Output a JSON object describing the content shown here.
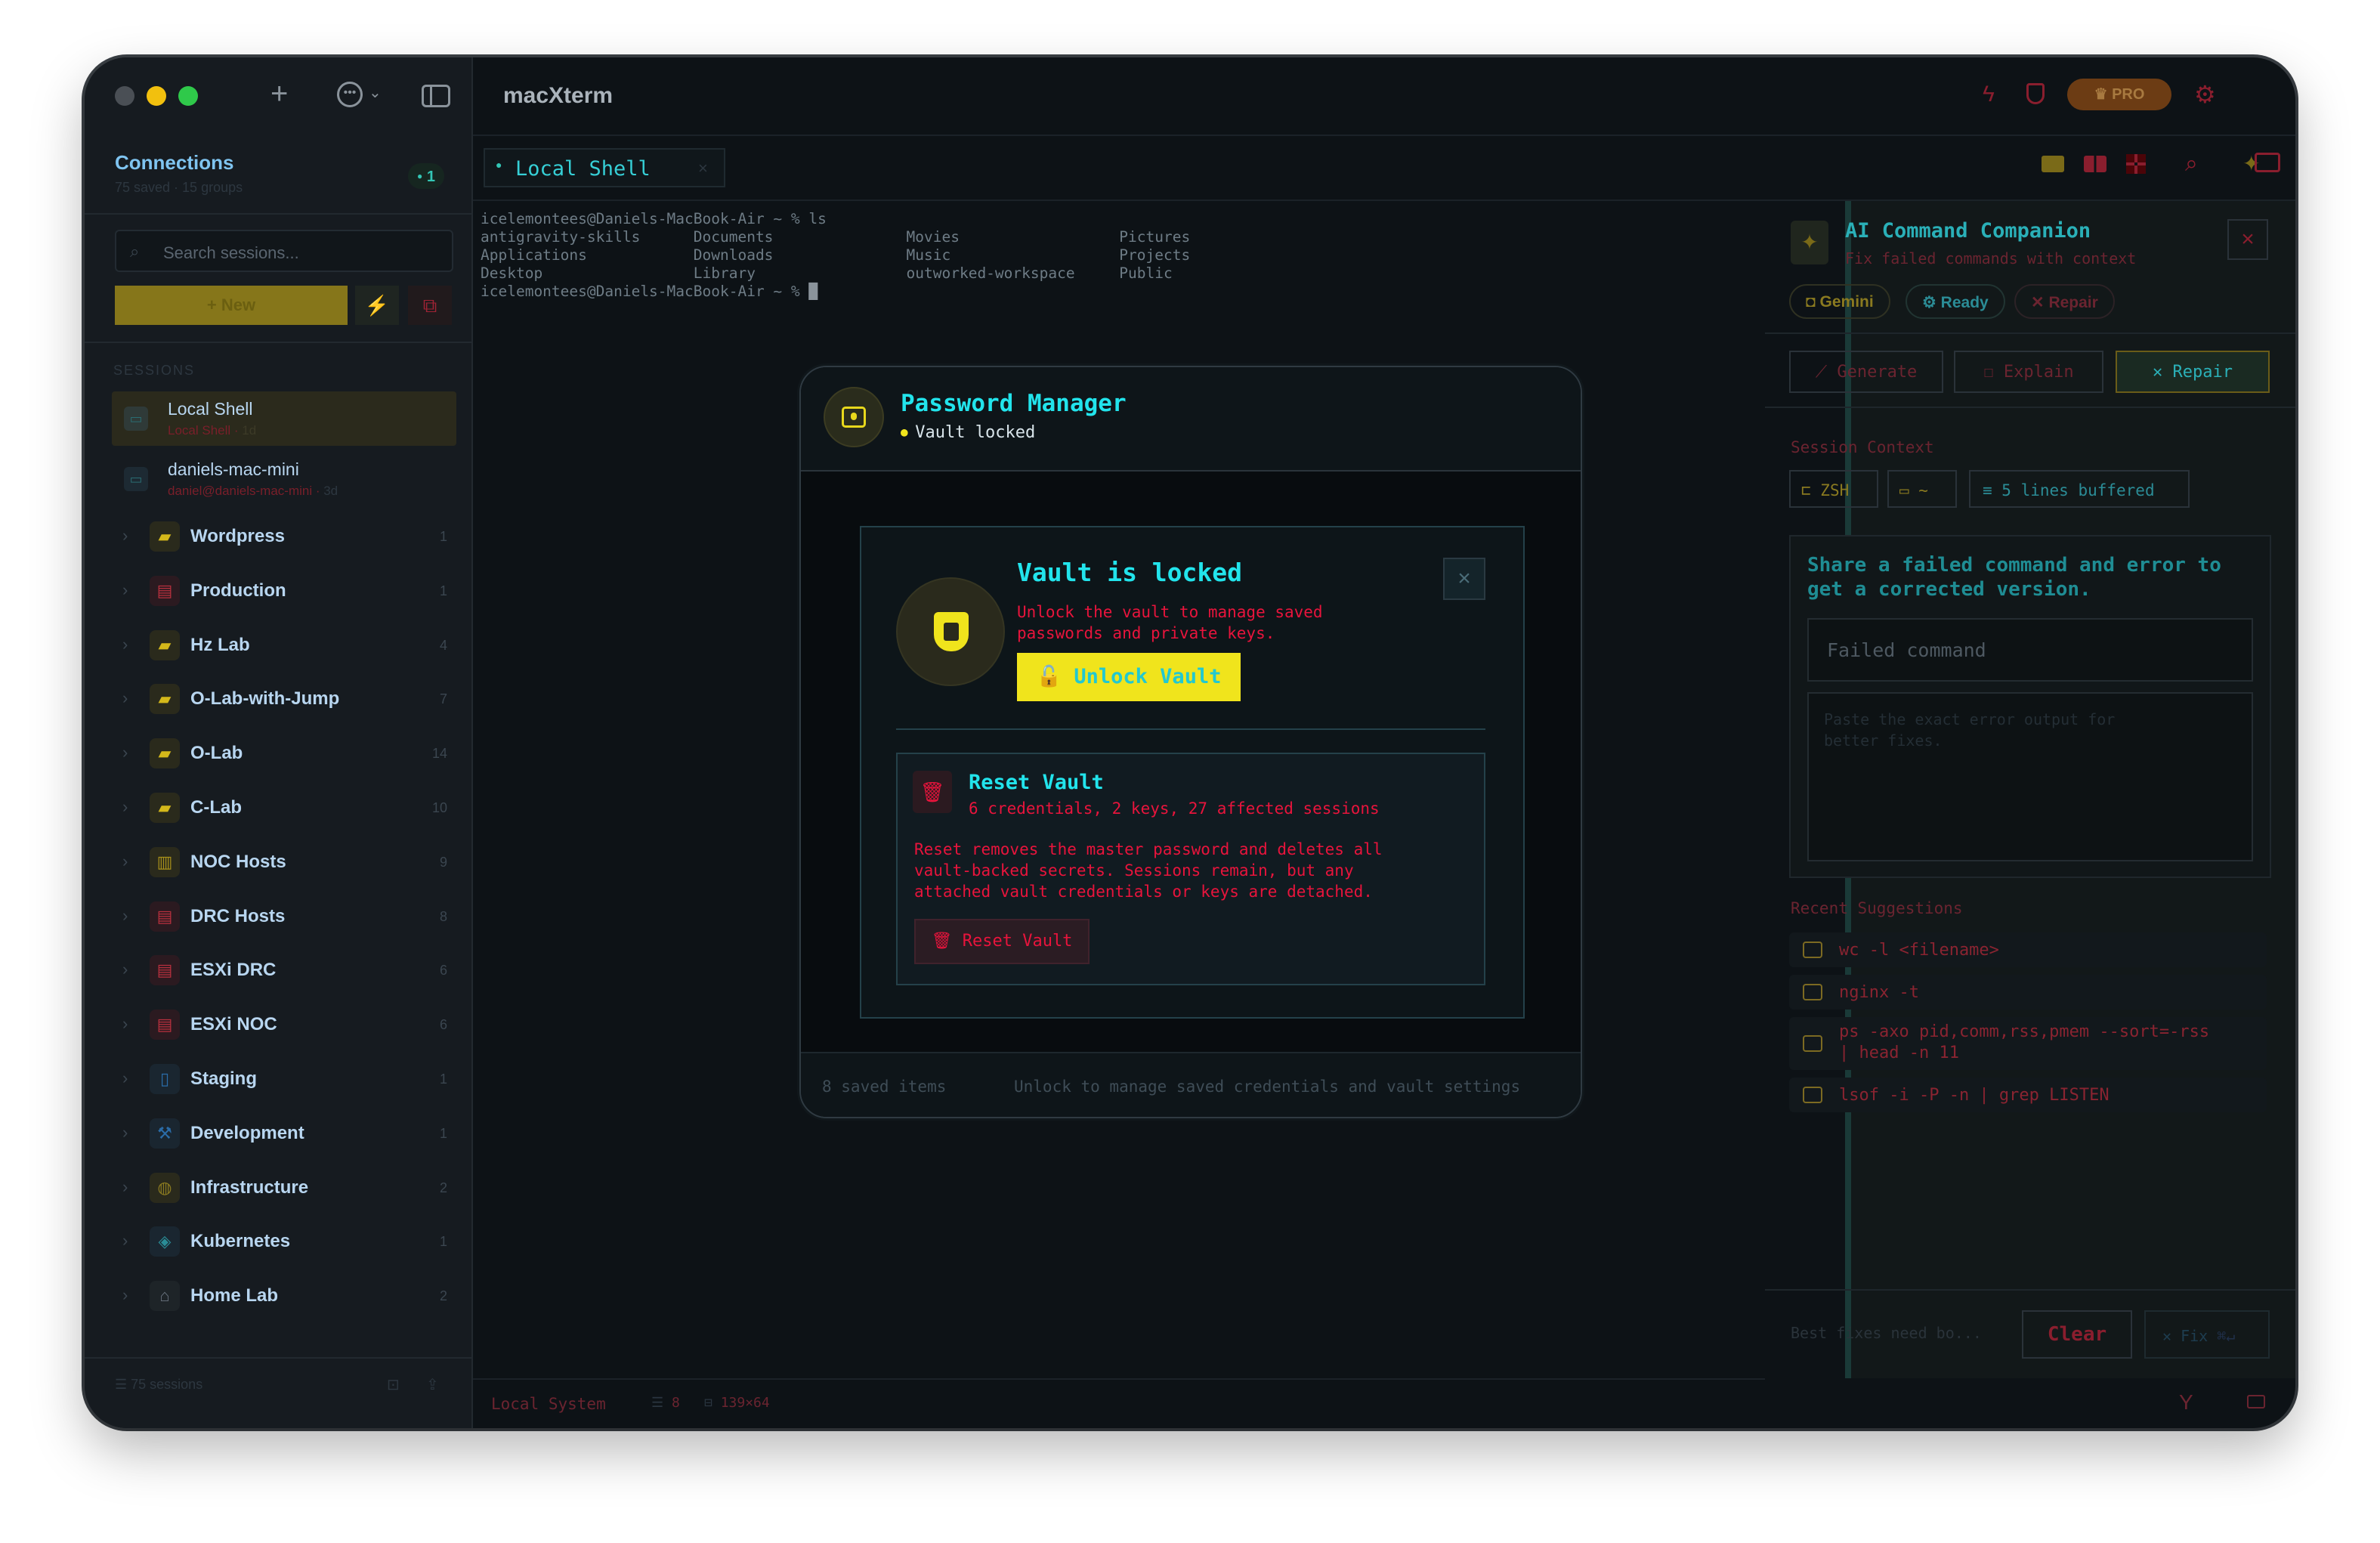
{
  "app": {
    "title": "macXterm"
  },
  "sidebar": {
    "title": "Connections",
    "subtitle": "75 saved · 15 groups",
    "badge": "1",
    "search_placeholder": "Search sessions...",
    "new_button": "+ New",
    "sessions_label": "SESSIONS",
    "sessions": [
      {
        "name": "Local Shell",
        "sub": "Local Shell",
        "meta": "1d"
      },
      {
        "name": "daniels-mac-mini",
        "sub": "daniel@daniels-mac-mini",
        "meta": "3d"
      }
    ],
    "groups": [
      {
        "label": "Wordpress",
        "count": "1",
        "icon": "folder-icon"
      },
      {
        "label": "Production",
        "count": "1",
        "icon": "server-icon"
      },
      {
        "label": "Hz Lab",
        "count": "4",
        "icon": "folder-icon"
      },
      {
        "label": "O-Lab-with-Jump",
        "count": "7",
        "icon": "folder-icon"
      },
      {
        "label": "O-Lab",
        "count": "14",
        "icon": "folder-icon"
      },
      {
        "label": "C-Lab",
        "count": "10",
        "icon": "folder-icon"
      },
      {
        "label": "NOC Hosts",
        "count": "9",
        "icon": "building-icon"
      },
      {
        "label": "DRC Hosts",
        "count": "8",
        "icon": "server-icon"
      },
      {
        "label": "ESXi DRC",
        "count": "6",
        "icon": "server-icon"
      },
      {
        "label": "ESXi NOC",
        "count": "6",
        "icon": "server-icon"
      },
      {
        "label": "Staging",
        "count": "1",
        "icon": "columns-icon"
      },
      {
        "label": "Development",
        "count": "1",
        "icon": "hammer-icon"
      },
      {
        "label": "Infrastructure",
        "count": "2",
        "icon": "globe-icon"
      },
      {
        "label": "Kubernetes",
        "count": "1",
        "icon": "layers-icon"
      },
      {
        "label": "Home Lab",
        "count": "2",
        "icon": "home-icon"
      }
    ],
    "footer": "75 sessions"
  },
  "tabs": [
    {
      "label": "Local Shell",
      "close": "×"
    }
  ],
  "toolbar": {
    "pro_label": "PRO"
  },
  "terminal": {
    "lines": [
      "icelemontees@Daniels-MacBook-Air ~ % ls",
      "antigravity-skills      Documents               Movies                  Pictures",
      "Applications            Downloads               Music                   Projects",
      "Desktop                 Library                 outworked-workspace     Public",
      "icelemontees@Daniels-MacBook-Air ~ % "
    ],
    "cursor": "█"
  },
  "statusbar": {
    "system": "Local System",
    "sessions": "8",
    "size": "139×64"
  },
  "modal": {
    "title": "Password Manager",
    "status": "Vault locked",
    "locked_title": "Vault is locked",
    "locked_desc_1": "Unlock the vault to manage saved",
    "locked_desc_2": "passwords and private keys.",
    "unlock_button": "Unlock Vault",
    "reset_title": "Reset Vault",
    "reset_sub": "6 credentials, 2 keys, 27 affected sessions",
    "reset_desc_1": "Reset removes the master password and deletes all",
    "reset_desc_2": "vault-backed secrets. Sessions remain, but any",
    "reset_desc_3": "attached vault credentials or keys are detached.",
    "reset_button": "Reset Vault",
    "footer_left": "8 saved items",
    "footer_right": "Unlock to manage saved credentials and vault settings",
    "close": "×"
  },
  "ai": {
    "title": "AI Command Companion",
    "subtitle": "Fix failed commands with context",
    "chips": [
      "Gemini",
      "Ready",
      "Repair"
    ],
    "actions": [
      "Generate",
      "Explain",
      "Repair"
    ],
    "context_label": "Session Context",
    "context": [
      "ZSH",
      "~",
      "5 lines buffered"
    ],
    "prompt": "Share a failed command and error to get a corrected version.",
    "failed_placeholder": "Failed command",
    "error_placeholder_1": "Paste the exact error output for",
    "error_placeholder_2": "better fixes.",
    "recent_label": "Recent Suggestions",
    "suggestions": [
      "wc -l <filename>",
      "nginx -t",
      "ps -axo pid,comm,rss,pmem --sort=-rss",
      "| head -n 11",
      "lsof -i -P -n | grep LISTEN"
    ],
    "footer_hint": "Best fixes need bo...",
    "clear_button": "Clear",
    "fix_button": "Fix",
    "fix_shortcut": "⌘↵"
  },
  "colors": {
    "accent": "#f0e41c",
    "cyan": "#21e0e8",
    "danger": "#e8143c",
    "bg": "#0d1216"
  }
}
